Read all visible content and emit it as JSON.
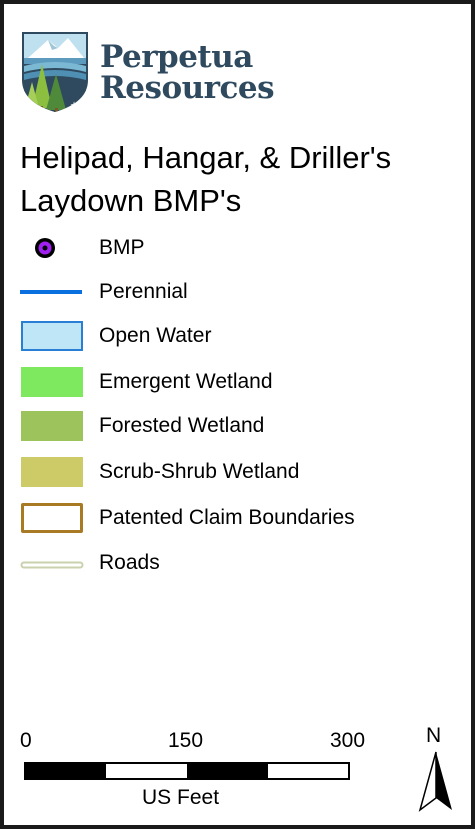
{
  "logo": {
    "line1": "Perpetua",
    "line2": "Resources"
  },
  "title": {
    "line1": "Helipad, Hangar, & Driller's",
    "line2": "Laydown BMP's"
  },
  "legend": {
    "items": [
      {
        "label": "BMP",
        "symbol": "point-circle",
        "fill": "#000000",
        "ring": "#a020f0"
      },
      {
        "label": "Perennial",
        "symbol": "line",
        "color": "#0a70e0"
      },
      {
        "label": "Open Water",
        "symbol": "polygon",
        "fill": "#bfe6f7",
        "outline": "#2a7fd4"
      },
      {
        "label": "Emergent Wetland",
        "symbol": "polygon",
        "fill": "#7ee85e"
      },
      {
        "label": "Forested Wetland",
        "symbol": "polygon",
        "fill": "#9cc35c"
      },
      {
        "label": "Scrub-Shrub Wetland",
        "symbol": "polygon",
        "fill": "#cccb68"
      },
      {
        "label": "Patented Claim Boundaries",
        "symbol": "polygon-outline",
        "outline": "#a87a23"
      },
      {
        "label": "Roads",
        "symbol": "road",
        "color": "#c9d2ad"
      }
    ]
  },
  "scale_bar": {
    "ticks": [
      "0",
      "150",
      "300"
    ],
    "unit": "US Feet"
  },
  "north_arrow": {
    "label": "N"
  }
}
